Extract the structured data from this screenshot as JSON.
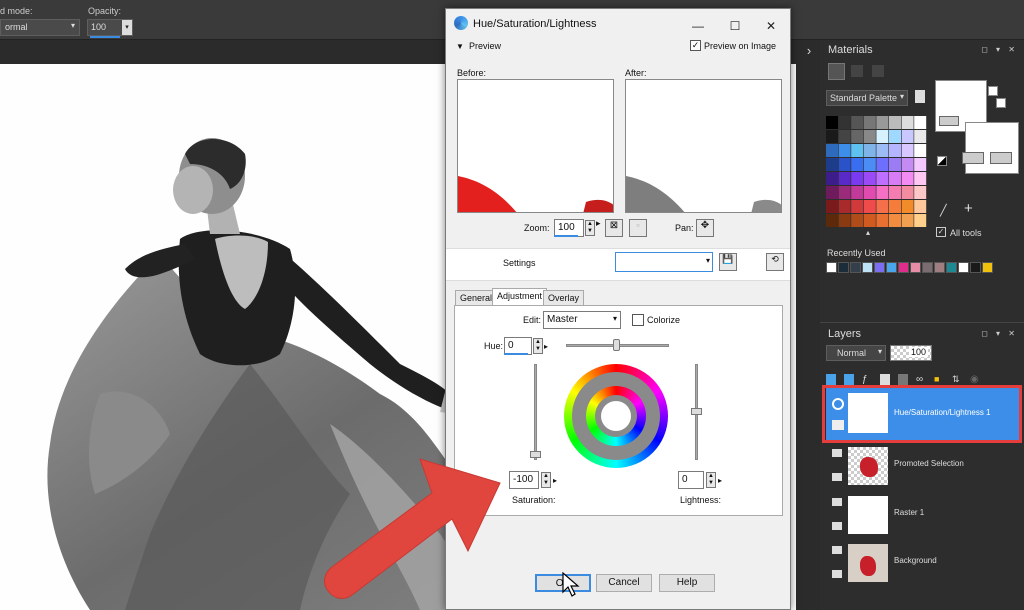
{
  "toolbar": {
    "blend_label": "d mode:",
    "blend_value": "ormal",
    "opacity_label": "Opacity:",
    "opacity_value": "100"
  },
  "materials": {
    "title": "Materials",
    "palette_label": "Standard Palette",
    "all_tools_label": "All tools",
    "recent_label": "Recently Used",
    "recent_colors": [
      "#ffffff",
      "#1c2d3a",
      "#33404c",
      "#bfe3f6",
      "#7b6ef3",
      "#4aa6ea",
      "#e02d8c",
      "#e88ca7",
      "#7a6d72",
      "#a07d80",
      "#1d8a93",
      "#ffffff",
      "#1a1a1a",
      "#f1c20c"
    ]
  },
  "layers": {
    "title": "Layers",
    "blend": "Normal",
    "opacity": "100",
    "items": [
      {
        "name": "Hue/Saturation/Lightness 1"
      },
      {
        "name": "Promoted Selection"
      },
      {
        "name": "Raster 1"
      },
      {
        "name": "Background"
      }
    ]
  },
  "dialog": {
    "title": "Hue/Saturation/Lightness",
    "preview_toggle": "Preview",
    "preview_on_image": "Preview on Image",
    "before_label": "Before:",
    "after_label": "After:",
    "zoom_label": "Zoom:",
    "zoom_value": "100",
    "pan_label": "Pan:",
    "settings_label": "Settings",
    "tabs": [
      "General",
      "Adjustment",
      "Overlay"
    ],
    "edit_label": "Edit:",
    "edit_value": "Master",
    "colorize_label": "Colorize",
    "hue_label": "Hue:",
    "hue_value": "0",
    "saturation_value": "-100",
    "saturation_label": "Saturation:",
    "lightness_value": "0",
    "lightness_label": "Lightness:",
    "ok_label": "OK",
    "cancel_label": "Cancel",
    "help_label": "Help"
  },
  "colors": {
    "highlight": "#e53c3c",
    "selection": "#3d8ee8",
    "arrow": "#e0453e"
  }
}
